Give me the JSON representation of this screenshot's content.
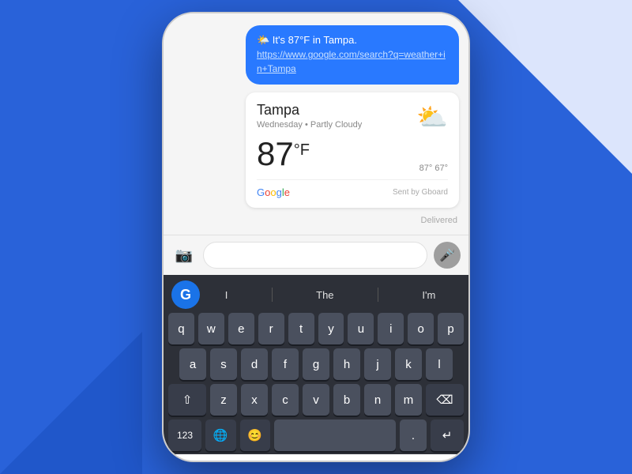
{
  "background": {
    "color": "#2962d9"
  },
  "phone": {
    "message_bubble": {
      "text": "🌤️ It's 87°F in Tampa.",
      "link": "https://www.google.com/search?q=weather+in+Tampa"
    },
    "weather_card": {
      "city": "Tampa",
      "day": "Wednesday",
      "condition": "Partly Cloudy",
      "temp": "87",
      "unit": "°F",
      "high": "87°",
      "low": "67°",
      "icon": "⛅",
      "source": "Google",
      "sent_by": "Sent by Gboard",
      "delivered": "Delivered"
    },
    "input_bar": {
      "placeholder": ""
    },
    "keyboard": {
      "suggestions": {
        "left": "I",
        "center": "The",
        "right": "I'm"
      },
      "gboard_label": "G",
      "rows": {
        "row1": [
          "q",
          "w",
          "e",
          "r",
          "t",
          "y",
          "u",
          "i",
          "o",
          "p"
        ],
        "row2": [
          "a",
          "s",
          "d",
          "f",
          "g",
          "h",
          "j",
          "k",
          "l"
        ],
        "row3": [
          "z",
          "x",
          "c",
          "v",
          "b",
          "n",
          "m"
        ],
        "row4_left": [
          "123",
          "🌐",
          "😊"
        ],
        "row4_right": [
          ".",
          "↵"
        ]
      },
      "special_keys": {
        "shift": "⇧",
        "backspace": "⌫",
        "num": "123",
        "globe": "🌐",
        "emoji": "😊",
        "space": "",
        "period": ".",
        "enter": "↵"
      }
    }
  }
}
